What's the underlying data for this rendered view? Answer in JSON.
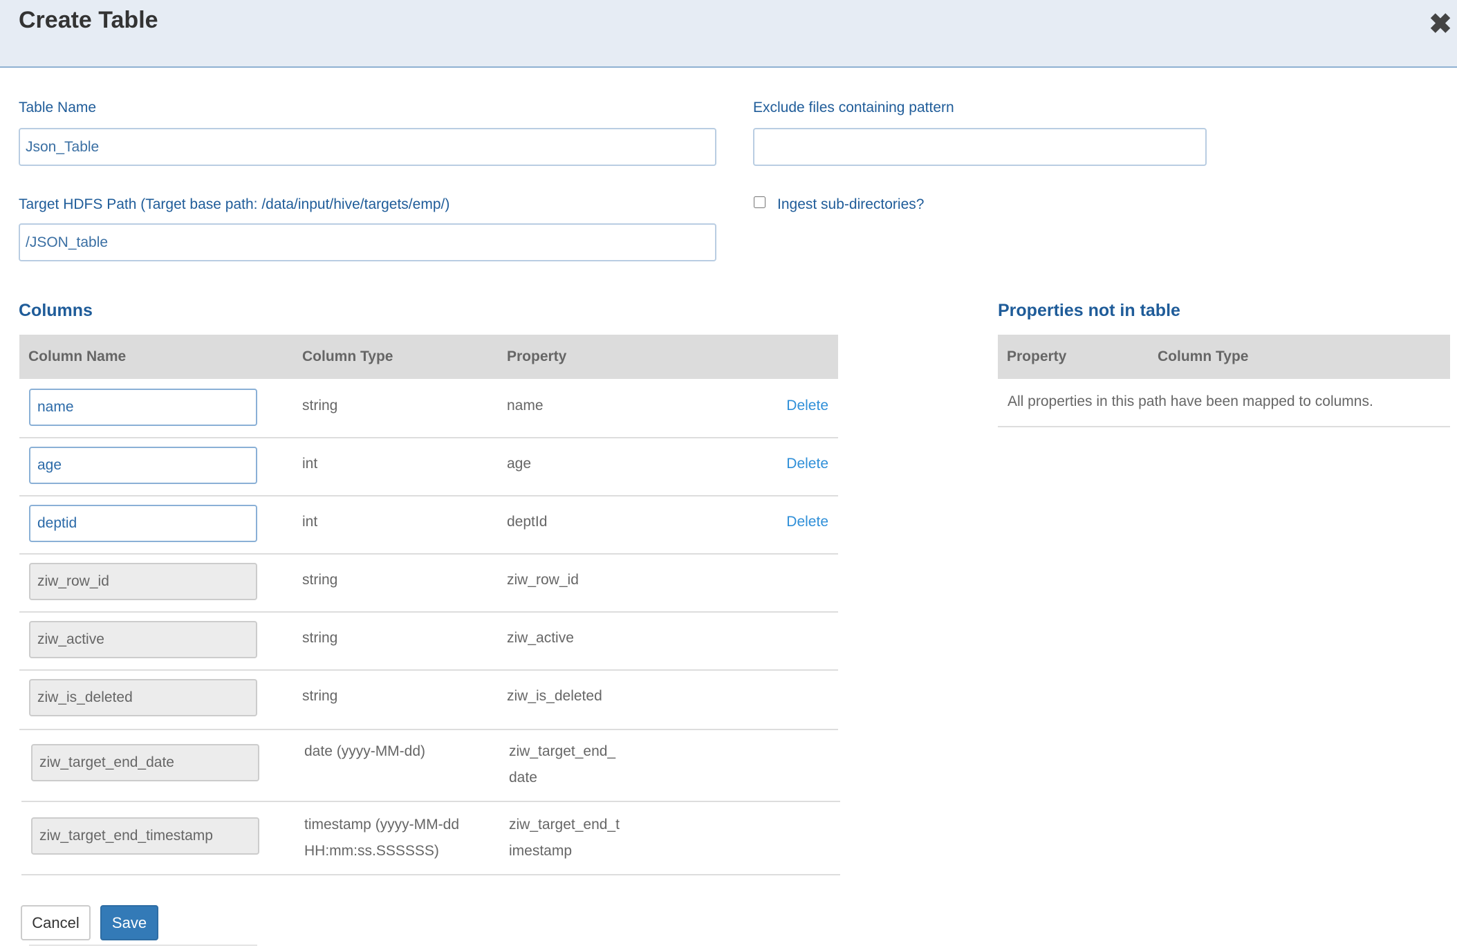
{
  "modal": {
    "title": "Create Table",
    "close_label": "✖"
  },
  "form": {
    "table_name_label": "Table Name",
    "table_name_value": "Json_Table",
    "exclude_label": "Exclude files containing pattern",
    "exclude_value": "",
    "target_path_label": "Target HDFS Path (Target base path: /data/input/hive/targets/emp/)",
    "target_path_value": "/JSON_table",
    "ingest_subdirs_label": "Ingest sub-directories?",
    "ingest_subdirs_checked": false
  },
  "columns": {
    "title": "Columns",
    "headers": [
      "Column Name",
      "Column Type",
      "Property"
    ],
    "delete_label": "Delete",
    "rows": [
      {
        "name": "name",
        "type": "string",
        "property": "name",
        "editable": true
      },
      {
        "name": "age",
        "type": "int",
        "property": "age",
        "editable": true
      },
      {
        "name": "deptid",
        "type": "int",
        "property": "deptId",
        "editable": true
      },
      {
        "name": "ziw_row_id",
        "type": "string",
        "property": "ziw_row_id",
        "editable": false
      },
      {
        "name": "ziw_active",
        "type": "string",
        "property": "ziw_active",
        "editable": false
      },
      {
        "name": "ziw_is_deleted",
        "type": "string",
        "property": "ziw_is_deleted",
        "editable": false
      },
      {
        "name": "ziw_target_end_date",
        "type": "date (yyyy-MM-dd)",
        "property": "ziw_target_end_\ndate",
        "editable": false
      },
      {
        "name": "ziw_target_end_timestamp",
        "type": "timestamp (yyyy-MM-dd\nHH:mm:ss.SSSSSS)",
        "property": "ziw_target_end_t\nimestamp",
        "editable": false
      }
    ]
  },
  "properties_panel": {
    "title": "Properties not in table",
    "headers": [
      "Property",
      "Column Type"
    ],
    "empty_message": "All properties in this path have been mapped to columns."
  },
  "footer": {
    "cancel_label": "Cancel",
    "save_label": "Save"
  }
}
